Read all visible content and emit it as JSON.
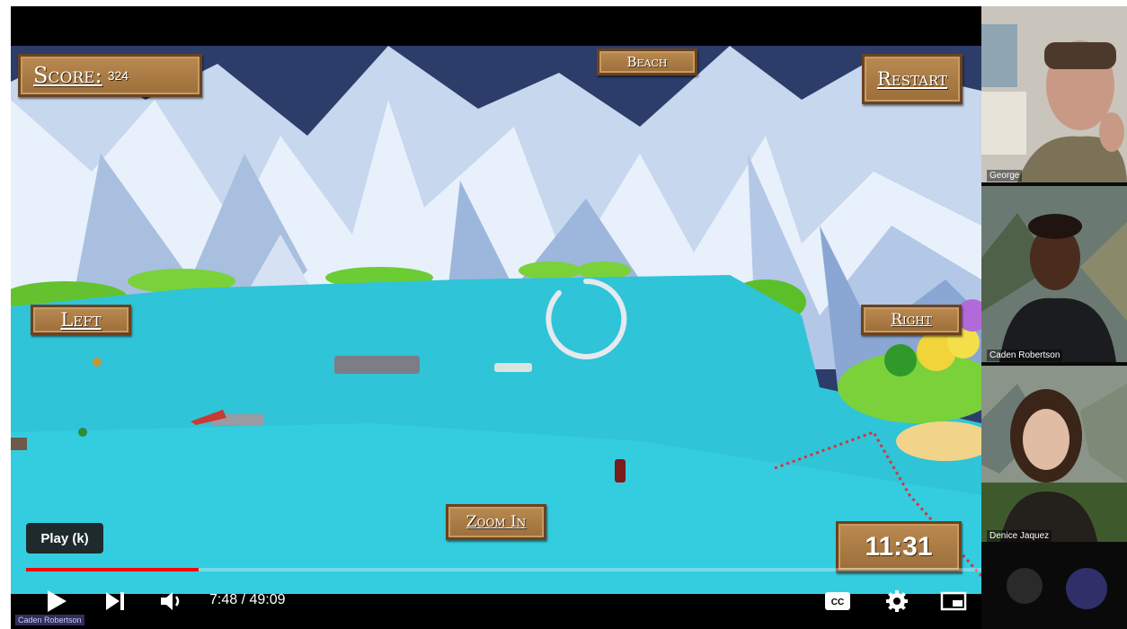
{
  "game": {
    "score_label": "Score:",
    "score_value": "324",
    "beach_label": "Beach",
    "restart_label": "Restart",
    "left_label": "Left",
    "right_label": "Right",
    "zoom_label": "Zoom In",
    "timer": "11:31"
  },
  "player": {
    "tooltip": "Play (k)",
    "current_time": "7:48",
    "separator": " / ",
    "duration": "49:09",
    "progress_fraction": 0.159,
    "accent_color": "#ff0000"
  },
  "participants": [
    {
      "name": "George"
    },
    {
      "name": "Caden Robertson"
    },
    {
      "name": "Denice Jaquez"
    }
  ],
  "bottom_overlay_name": "Caden Robertson"
}
